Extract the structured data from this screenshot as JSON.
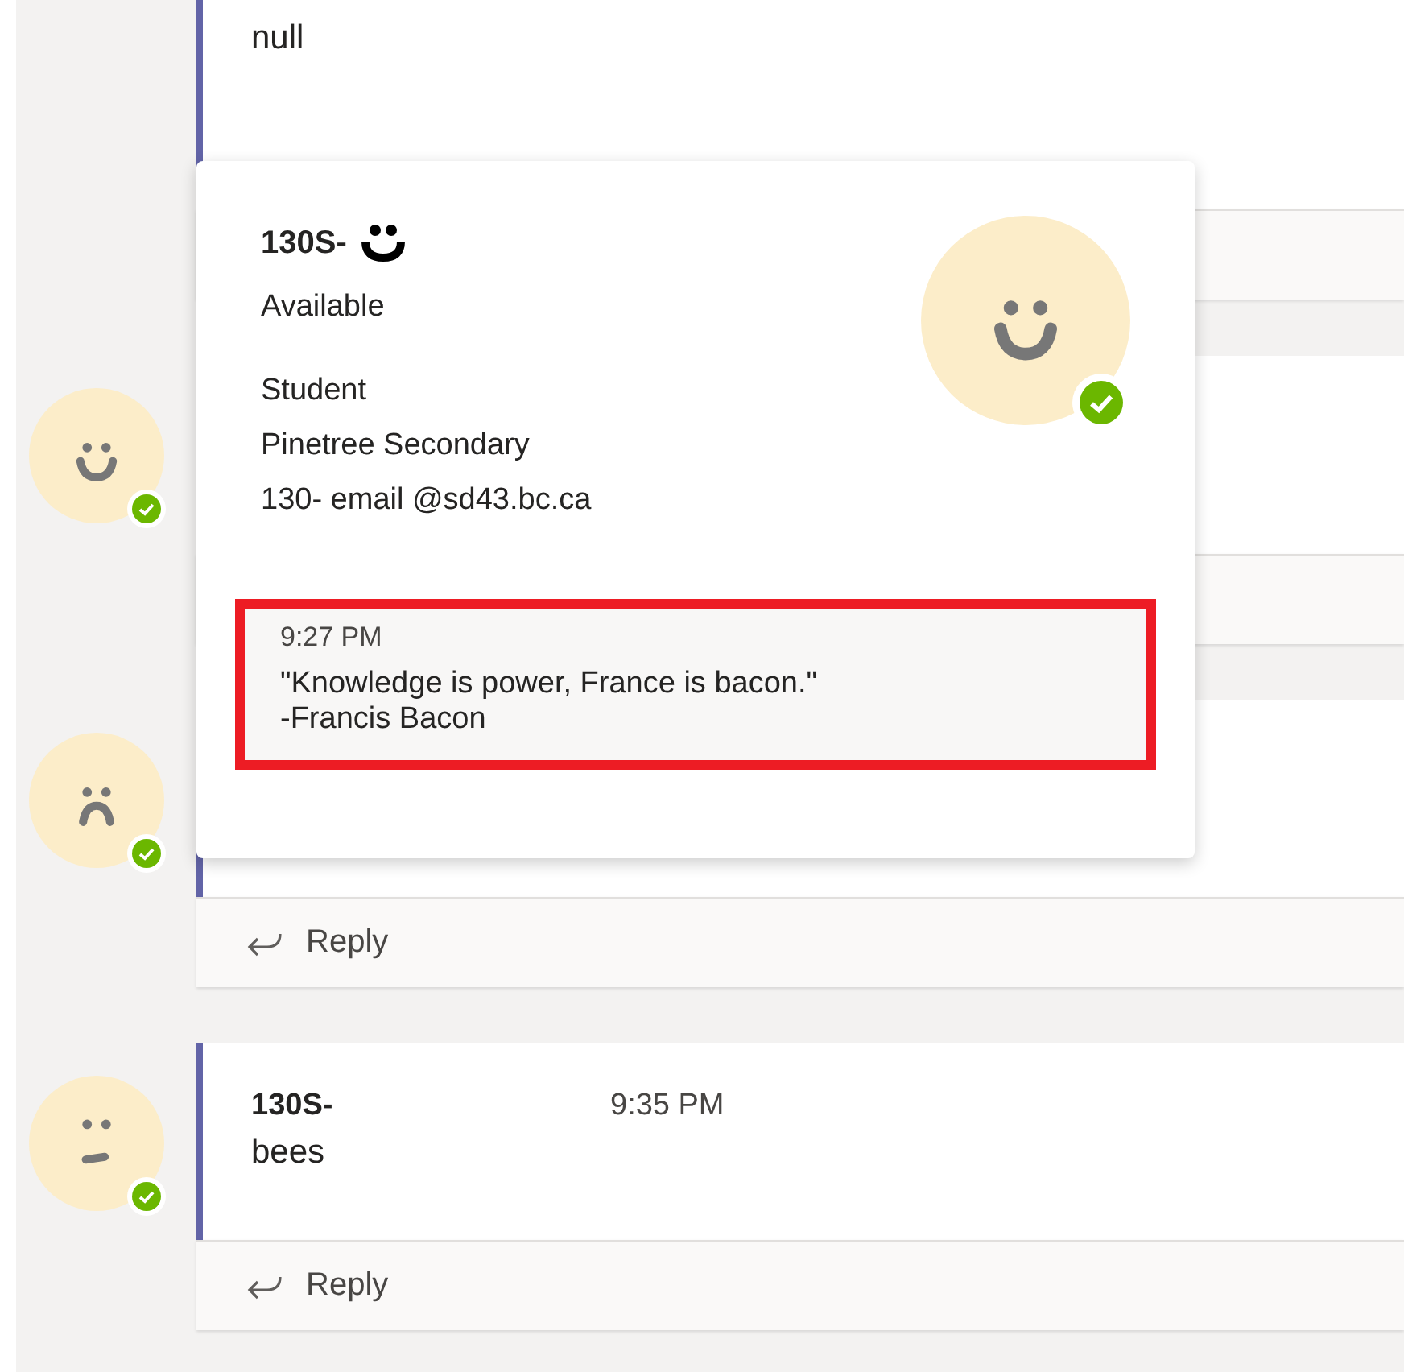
{
  "threads": [
    {
      "lines": [
        "null"
      ]
    },
    {
      "avatar": {
        "kind": "smile",
        "online": true
      }
    },
    {
      "avatar": {
        "kind": "frown",
        "online": true
      },
      "reply": "Reply"
    },
    {
      "avatar": {
        "kind": "flat",
        "online": true
      },
      "author": "130S-",
      "time": "9:35 PM",
      "lines": [
        "bees"
      ],
      "reply": "Reply"
    }
  ],
  "profile_card": {
    "name": "130S-",
    "status": "Available",
    "role": "Student",
    "school": "Pinetree Secondary",
    "email": "130- email @sd43.bc.ca",
    "avatar": {
      "kind": "smile",
      "online": true
    },
    "note": {
      "time": "9:27 PM",
      "lines": [
        "\"Knowledge is power, France is bacon.\"",
        "-Francis Bacon"
      ]
    }
  }
}
